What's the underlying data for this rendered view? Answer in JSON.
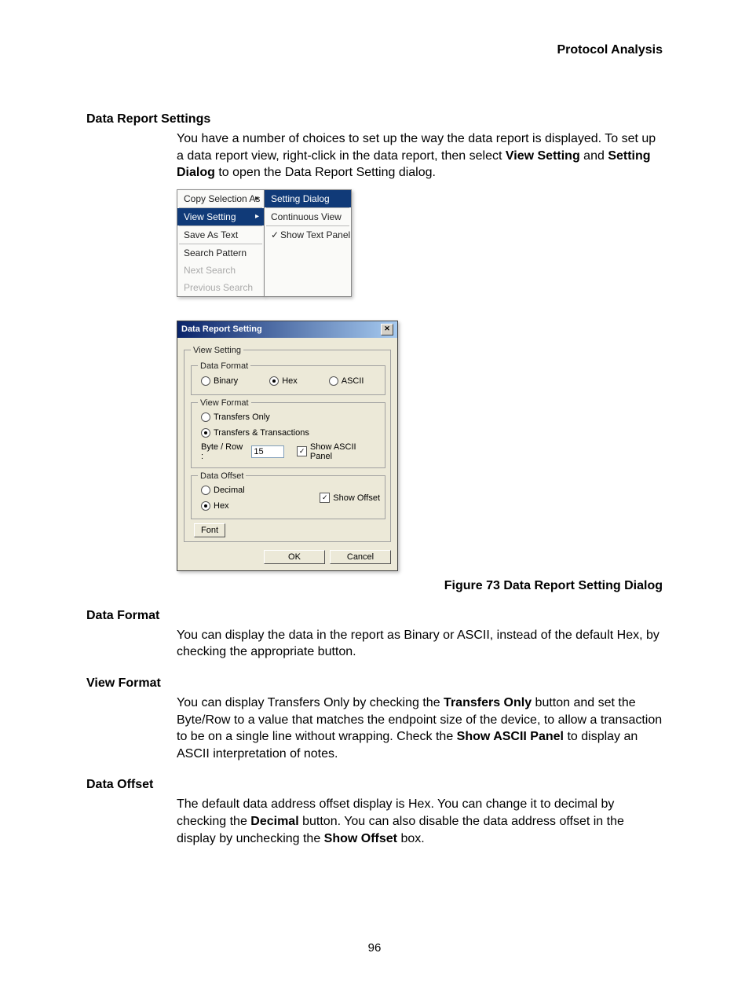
{
  "header": "Protocol Analysis",
  "section1": {
    "title": "Data Report Settings",
    "p1": "You have a number of choices to set up the way the data report is displayed. To set up a data report view, right-click in the data report, then select ",
    "b1": "View Setting",
    "mid": " and ",
    "b2": "Setting Dialog",
    "p2": " to open the Data Report Setting dialog."
  },
  "menu": {
    "left": {
      "copy": "Copy Selection As",
      "view": "View Setting",
      "save": "Save As Text",
      "search": "Search Pattern",
      "next": "Next Search",
      "prev": "Previous Search"
    },
    "right": {
      "setting": "Setting Dialog",
      "cont": "Continuous View",
      "show": "Show Text Panel"
    }
  },
  "dialog": {
    "title": "Data Report Setting",
    "fs_view": "View Setting",
    "fs_df": "Data Format",
    "df_binary": "Binary",
    "df_hex": "Hex",
    "df_ascii": "ASCII",
    "fs_vf": "View Format",
    "vf_to": "Transfers Only",
    "vf_tt": "Transfers & Transactions",
    "byterow": "Byte / Row :",
    "byterow_val": "15",
    "show_ascii": "Show ASCII Panel",
    "fs_do": "Data Offset",
    "do_dec": "Decimal",
    "do_hex": "Hex",
    "show_offset": "Show Offset",
    "font": "Font",
    "ok": "OK",
    "cancel": "Cancel"
  },
  "fig_caption": "Figure  73  Data Report Setting Dialog",
  "data_format": {
    "title": "Data Format",
    "p": "You can display the data in the report as Binary or ASCII, instead of the default Hex, by checking the appropriate button."
  },
  "view_format": {
    "title": "View Format",
    "p1": "You can display Transfers Only by checking the ",
    "b1": "Transfers Only",
    "p2": " button and set the Byte/Row to a value that matches the endpoint size of the device, to allow a transaction to be on a single line without wrapping. Check the ",
    "b2": "Show ASCII Panel",
    "p3": " to display an ASCII interpretation of notes."
  },
  "data_offset": {
    "title": "Data Offset",
    "p1": "The default data address offset display is Hex. You can change it to decimal by checking the ",
    "b1": "Decimal",
    "p2": " button. You can also disable the data address offset in the display by unchecking the ",
    "b2": "Show Offset",
    "p3": " box."
  },
  "page_num": "96"
}
